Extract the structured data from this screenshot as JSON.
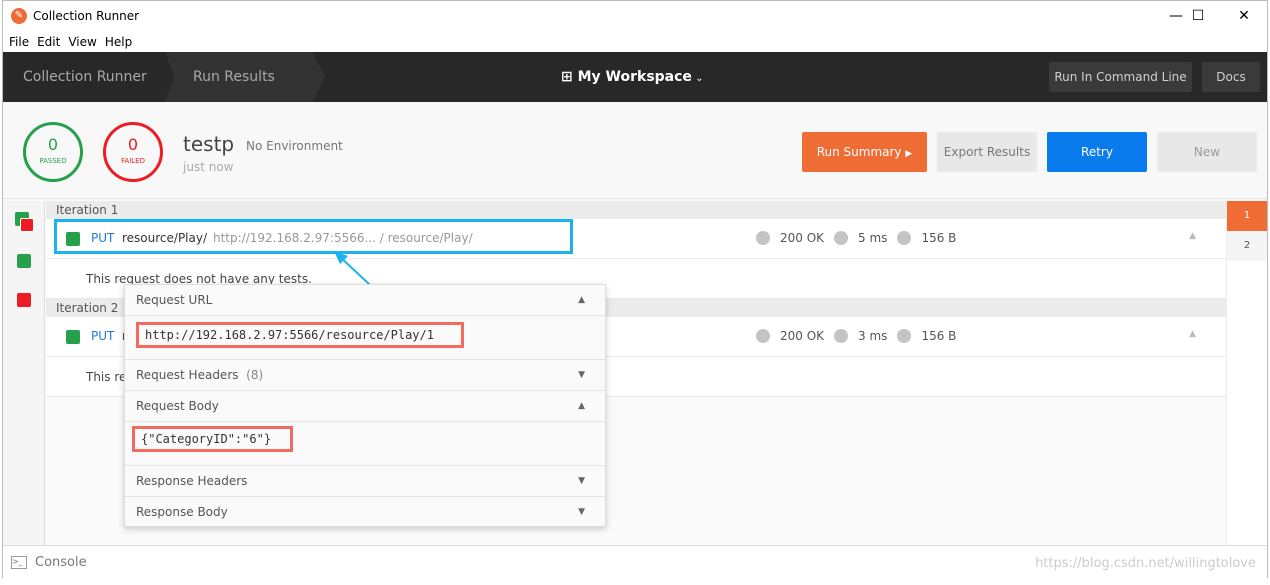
{
  "window": {
    "title": "Collection Runner",
    "minimize": "—",
    "maximize": "☐",
    "close": "✕"
  },
  "menu": [
    "File",
    "Edit",
    "View",
    "Help"
  ],
  "nav": {
    "crumbs": [
      "Collection Runner",
      "Run Results"
    ],
    "workspace": "My Workspace",
    "run_cli": "Run In Command Line",
    "docs": "Docs"
  },
  "summary": {
    "passed": "0",
    "passed_label": "PASSED",
    "failed": "0",
    "failed_label": "FAILED",
    "name": "testp",
    "environment": "No Environment",
    "time": "just now"
  },
  "buttons": {
    "run_summary": "Run Summary",
    "export": "Export Results",
    "retry": "Retry",
    "new": "New"
  },
  "iterations": [
    {
      "label": "Iteration 1",
      "method": "PUT",
      "path": "resource/Play/",
      "url": "http://192.168.2.97:5566...          / resource/Play/",
      "status": "200 OK",
      "time": "5 ms",
      "size": "156 B",
      "note": "This request does not have any tests."
    },
    {
      "label": "Iteration 2",
      "method": "PUT",
      "path": "r",
      "url": "",
      "status": "200 OK",
      "time": "3 ms",
      "size": "156 B",
      "note": "This req"
    }
  ],
  "pages": [
    "1",
    "2"
  ],
  "popup": {
    "request_url": "Request URL",
    "url_value": "http://192.168.2.97:5566/resource/Play/1",
    "request_headers": "Request Headers",
    "headers_count": "(8)",
    "request_body": "Request Body",
    "body_value": "{\"CategoryID\":\"6\"}",
    "response_headers": "Response Headers",
    "response_body": "Response Body"
  },
  "console": "Console",
  "watermark": "https://blog.csdn.net/willingtolove",
  "colors": {
    "accent": "#ef6c35",
    "retry": "#097bed",
    "passed": "#26a04b",
    "failed": "#ed1c24",
    "highlight": "#1ab3ef",
    "annotation": "#f26b5e"
  }
}
